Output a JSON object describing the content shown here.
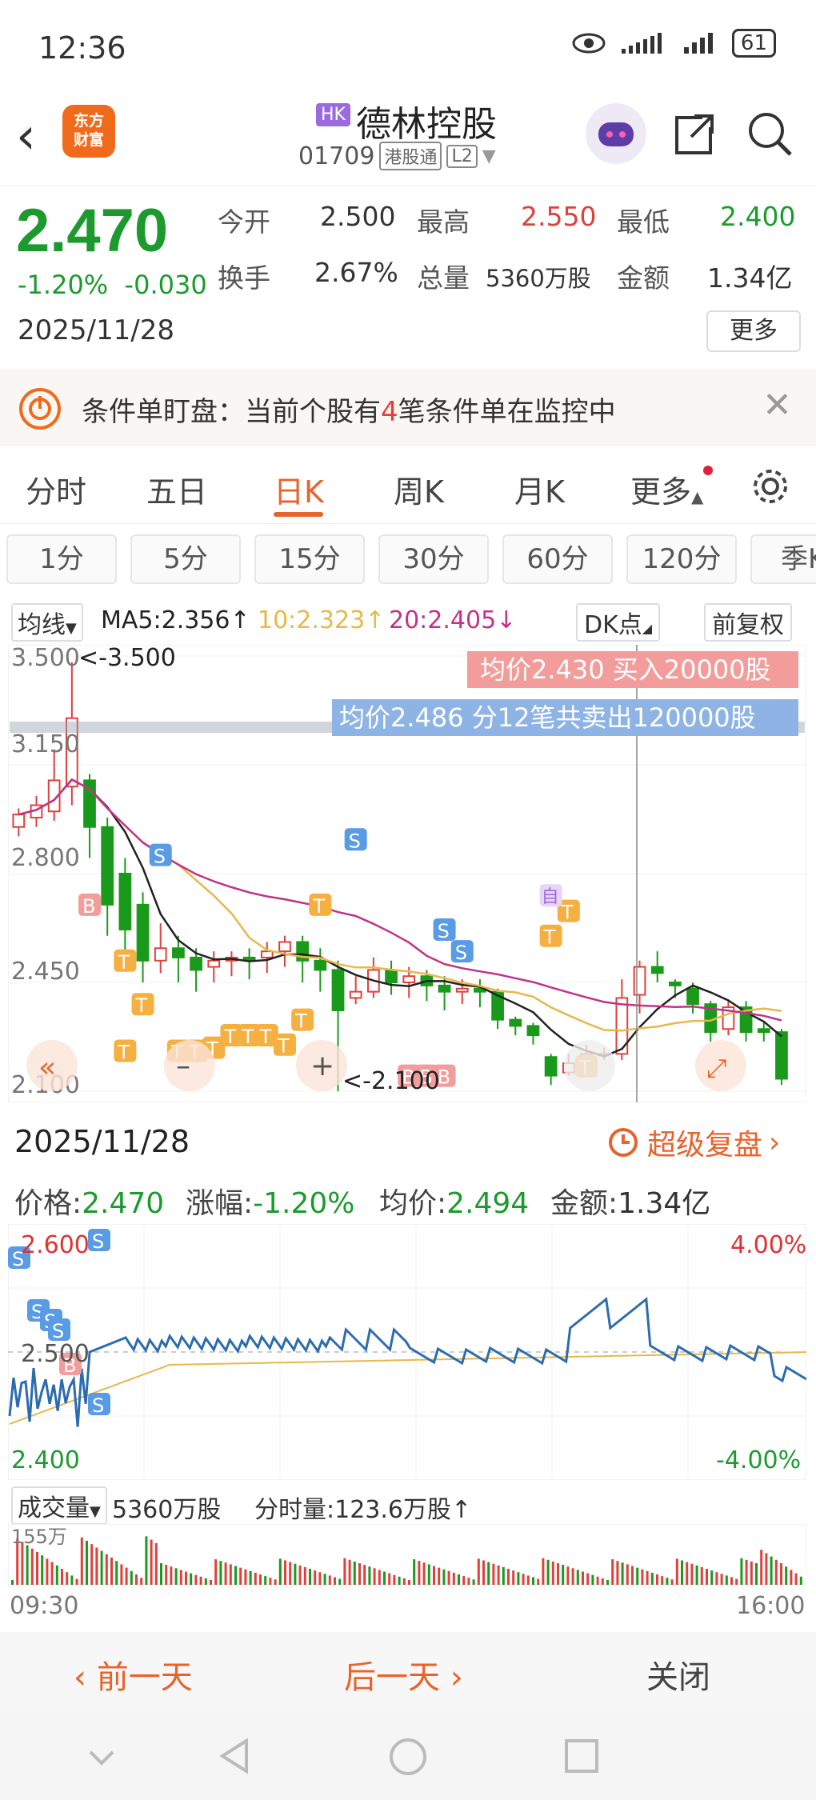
{
  "status": {
    "time": "12:36",
    "battery": "61"
  },
  "header": {
    "app_logo_line1": "东方",
    "app_logo_line2": "财富",
    "market_badge": "HK",
    "name": "德林控股",
    "code": "01709",
    "connect": "港股通",
    "level": "L2"
  },
  "quote": {
    "price": "2.470",
    "change_pct": "-1.20%",
    "change": "-0.030",
    "date": "2025/11/28",
    "open_label": "今开",
    "open": "2.500",
    "high_label": "最高",
    "high": "2.550",
    "low_label": "最低",
    "low": "2.400",
    "turnover_label": "换手",
    "turnover": "2.67%",
    "volume_label": "总量",
    "volume": "5360万股",
    "amount_label": "金额",
    "amount": "1.34亿",
    "more": "更多"
  },
  "banner": {
    "text_a": "条件单盯盘：当前个股有",
    "count": "4",
    "text_b": "笔条件单在监控中"
  },
  "period_tabs": [
    "分时",
    "五日",
    "日K",
    "周K",
    "月K",
    "更多"
  ],
  "period_active": "日K",
  "minute_tabs": [
    "1分",
    "5分",
    "15分",
    "30分",
    "60分",
    "120分",
    "季K"
  ],
  "ma": {
    "label": "均线",
    "ma5": "MA5:2.356↑",
    "ma10": "10:2.323↑",
    "ma20": "20:2.405↓",
    "dk": "DK点",
    "adjust": "前复权"
  },
  "kchart": {
    "y_ticks": [
      "3.500",
      "3.150",
      "2.800",
      "2.450",
      "2.100"
    ],
    "max_label": "<-3.500",
    "min_label": "<-2.100",
    "buy_banner": "均价2.430  买入20000股",
    "sell_banner": "均价2.486  分12笔共卖出120000股",
    "marker_b": "B",
    "marker_s": "S",
    "marker_t": "T",
    "marker_zi": "自",
    "colors": {
      "up": "#e0403c",
      "down": "#1a9a1a",
      "ma5": "#222222",
      "ma10": "#e8b84a",
      "ma20": "#c0338a"
    }
  },
  "chart_data": {
    "type": "candlestick",
    "ylim": [
      2.1,
      3.5
    ],
    "candles": [
      [
        2.95,
        2.99,
        2.92,
        3.01
      ],
      [
        2.98,
        3.02,
        2.95,
        3.05
      ],
      [
        3.0,
        3.1,
        2.97,
        3.2
      ],
      [
        3.08,
        3.3,
        3.02,
        3.48
      ],
      [
        3.1,
        2.95,
        2.85,
        3.12
      ],
      [
        2.95,
        2.7,
        2.6,
        2.98
      ],
      [
        2.8,
        2.62,
        2.55,
        2.85
      ],
      [
        2.7,
        2.52,
        2.45,
        2.74
      ],
      [
        2.52,
        2.56,
        2.48,
        2.64
      ],
      [
        2.56,
        2.53,
        2.45,
        2.6
      ],
      [
        2.53,
        2.49,
        2.42,
        2.56
      ],
      [
        2.5,
        2.52,
        2.45,
        2.55
      ],
      [
        2.52,
        2.53,
        2.47,
        2.55
      ],
      [
        2.53,
        2.52,
        2.46,
        2.56
      ],
      [
        2.53,
        2.55,
        2.48,
        2.58
      ],
      [
        2.55,
        2.58,
        2.5,
        2.6
      ],
      [
        2.58,
        2.52,
        2.45,
        2.6
      ],
      [
        2.52,
        2.49,
        2.42,
        2.56
      ],
      [
        2.49,
        2.36,
        2.1,
        2.52
      ],
      [
        2.4,
        2.42,
        2.38,
        2.47
      ],
      [
        2.42,
        2.49,
        2.4,
        2.53
      ],
      [
        2.49,
        2.45,
        2.41,
        2.52
      ],
      [
        2.45,
        2.47,
        2.4,
        2.5
      ],
      [
        2.47,
        2.44,
        2.39,
        2.49
      ],
      [
        2.44,
        2.42,
        2.36,
        2.47
      ],
      [
        2.42,
        2.43,
        2.38,
        2.46
      ],
      [
        2.43,
        2.42,
        2.37,
        2.46
      ],
      [
        2.42,
        2.33,
        2.3,
        2.43
      ],
      [
        2.33,
        2.31,
        2.28,
        2.34
      ],
      [
        2.31,
        2.28,
        2.25,
        2.32
      ],
      [
        2.21,
        2.15,
        2.12,
        2.22
      ],
      [
        2.16,
        2.19,
        2.15,
        2.22
      ],
      [
        2.2,
        2.22,
        2.19,
        2.25
      ],
      [
        2.22,
        2.22,
        2.2,
        2.24
      ],
      [
        2.22,
        2.4,
        2.2,
        2.46
      ],
      [
        2.41,
        2.5,
        2.35,
        2.52
      ],
      [
        2.5,
        2.48,
        2.45,
        2.55
      ],
      [
        2.45,
        2.44,
        2.4,
        2.46
      ],
      [
        2.43,
        2.38,
        2.35,
        2.45
      ],
      [
        2.38,
        2.29,
        2.26,
        2.39
      ],
      [
        2.3,
        2.37,
        2.28,
        2.39
      ],
      [
        2.37,
        2.29,
        2.26,
        2.39
      ],
      [
        2.3,
        2.29,
        2.26,
        2.32
      ],
      [
        2.29,
        2.14,
        2.12,
        2.3
      ]
    ]
  },
  "detail": {
    "date": "2025/11/28",
    "replay": "超级复盘",
    "price_label": "价格:",
    "price": "2.470",
    "change_label": "涨幅:",
    "change": "-1.20%",
    "avg_label": "均价:",
    "avg": "2.494",
    "amount_label": "金额:",
    "amount": "1.34亿"
  },
  "tchart": {
    "high": "2.600",
    "mid": "2.500",
    "low": "2.400",
    "pct_high": "4.00%",
    "pct_low": "-4.00%"
  },
  "volume": {
    "label": "成交量",
    "total": "5360万股",
    "tick": "分时量:123.6万股↑",
    "max": "155万",
    "time_start": "09:30",
    "time_end": "16:00"
  },
  "bottom": {
    "prev": "前一天",
    "next": "后一天",
    "close": "关闭"
  }
}
